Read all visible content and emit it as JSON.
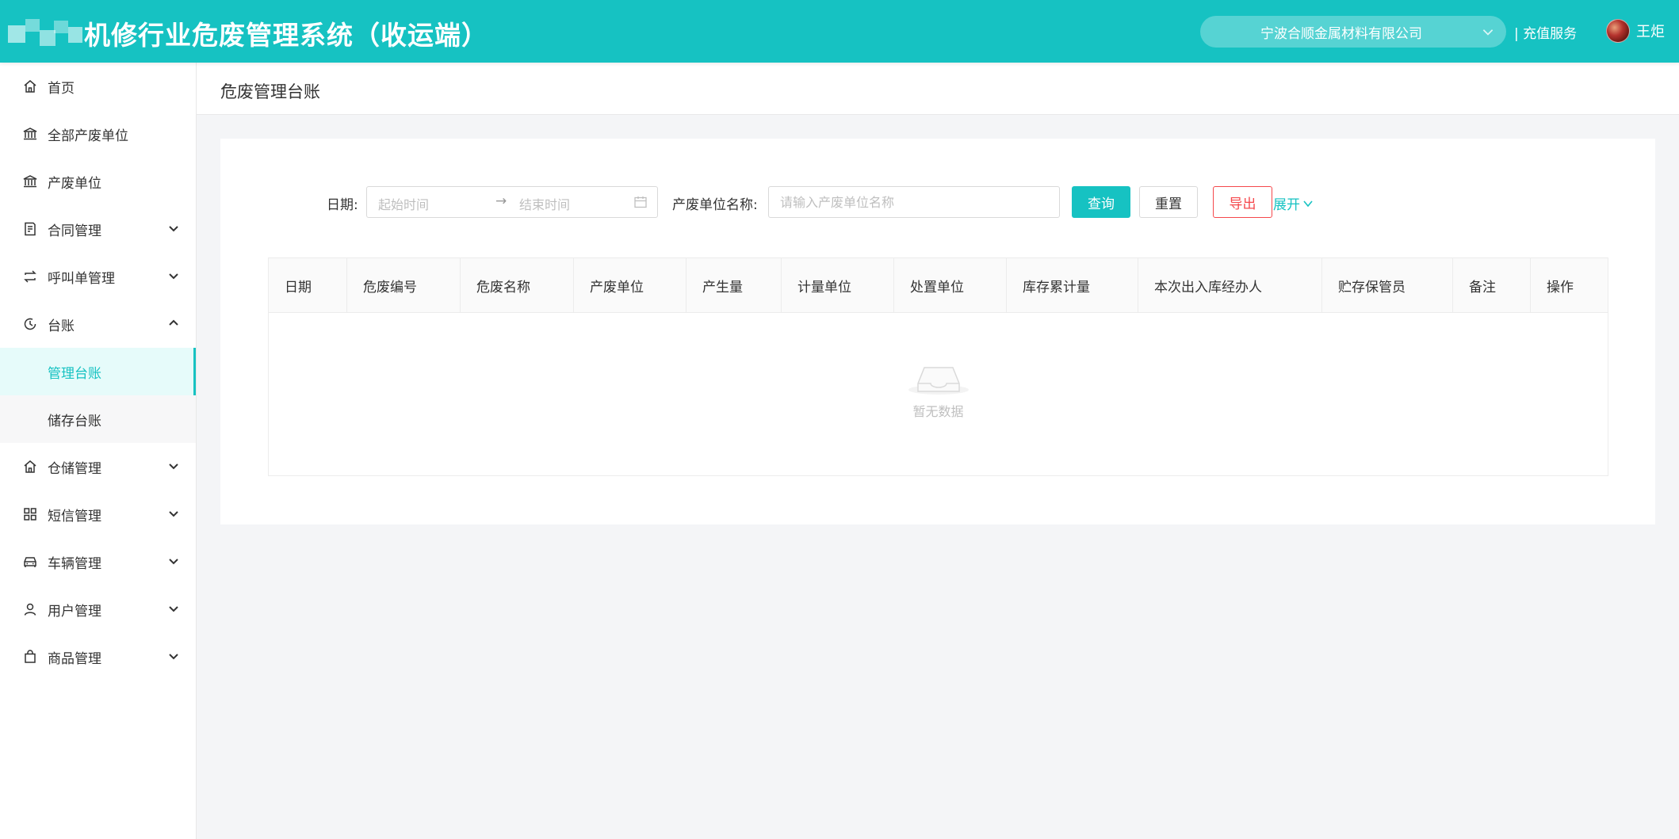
{
  "header": {
    "title": "机修行业危废管理系统（收运端）",
    "company": "宁波合顺金属材料有限公司",
    "recharge_label": "| 充值服务",
    "username": "王炬"
  },
  "sidebar": {
    "items": [
      {
        "label": "首页"
      },
      {
        "label": "全部产废单位"
      },
      {
        "label": "产废单位"
      },
      {
        "label": "合同管理"
      },
      {
        "label": "呼叫单管理"
      },
      {
        "label": "台账"
      },
      {
        "label": "管理台账"
      },
      {
        "label": "储存台账"
      },
      {
        "label": "仓储管理"
      },
      {
        "label": "短信管理"
      },
      {
        "label": "车辆管理"
      },
      {
        "label": "用户管理"
      },
      {
        "label": "商品管理"
      }
    ]
  },
  "page": {
    "title": "危废管理台账"
  },
  "filters": {
    "date_label": "日期:",
    "start_placeholder": "起始时间",
    "range_separator": "→",
    "end_placeholder": "结束时间",
    "unit_label": "产废单位名称:",
    "unit_placeholder": "请输入产废单位名称",
    "query_label": "查询",
    "reset_label": "重置",
    "export_label": "导出",
    "expand_label": "展开"
  },
  "table": {
    "columns": [
      "日期",
      "危废编号",
      "危废名称",
      "产废单位",
      "产生量",
      "计量单位",
      "处置单位",
      "库存累计量",
      "本次出入库经办人",
      "贮存保管员",
      "备注",
      "操作"
    ],
    "empty_text": "暂无数据"
  },
  "colors": {
    "primary": "#16c2c2",
    "danger": "#f5484c"
  }
}
